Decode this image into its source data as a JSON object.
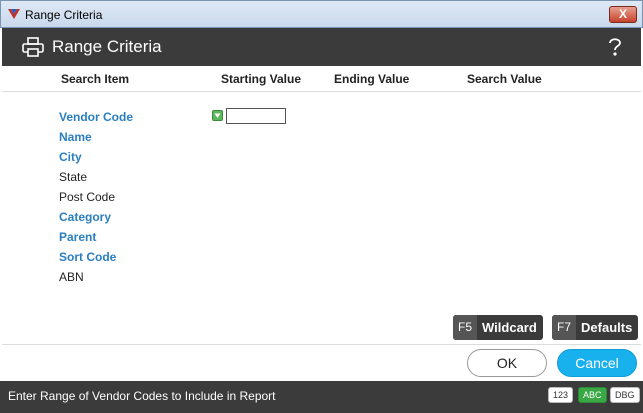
{
  "window": {
    "title": "Range Criteria",
    "close_symbol": "X"
  },
  "header": {
    "title": "Range Criteria",
    "help_symbol": "?"
  },
  "columns": {
    "search_item": "Search Item",
    "starting_value": "Starting Value",
    "ending_value": "Ending Value",
    "search_value": "Search Value"
  },
  "fields": [
    {
      "label": "Vendor Code",
      "active": true
    },
    {
      "label": "Name",
      "active": true
    },
    {
      "label": "City",
      "active": true
    },
    {
      "label": "State",
      "active": false
    },
    {
      "label": "Post Code",
      "active": false
    },
    {
      "label": "Category",
      "active": true
    },
    {
      "label": "Parent",
      "active": true
    },
    {
      "label": "Sort Code",
      "active": true
    },
    {
      "label": "ABN",
      "active": false
    }
  ],
  "vendor_code": {
    "starting_value": ""
  },
  "buttons": {
    "wildcard_key": "F5",
    "wildcard_label": "Wildcard",
    "defaults_key": "F7",
    "defaults_label": "Defaults",
    "ok": "OK",
    "cancel": "Cancel"
  },
  "status": {
    "text": "Enter Range of Vendor Codes to Include in Report",
    "badges": [
      "123",
      "ABC",
      "DBG"
    ]
  },
  "colors": {
    "accent": "#2a7fc1",
    "header_bg": "#3b3b3b",
    "cancel_bg": "#19b0ee",
    "badge_on": "#39a845"
  }
}
